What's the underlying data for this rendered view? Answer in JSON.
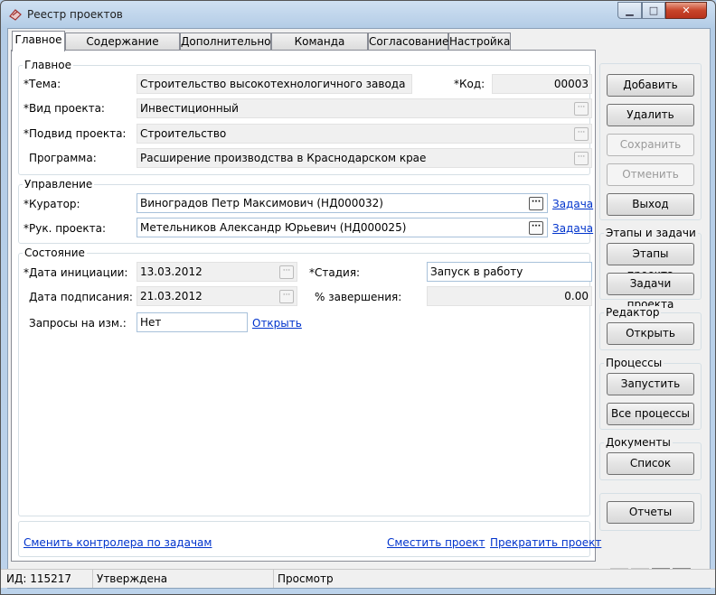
{
  "window": {
    "title": "Реестр проектов"
  },
  "tabs": [
    "Главное",
    "Содержание проекта",
    "Дополнительно",
    "Команда проекта",
    "Согласование",
    "Настройка"
  ],
  "main_group": {
    "title": "Главное",
    "tema_label": "*Тема:",
    "tema_value": "Строительство высокотехнологичного завода",
    "kod_label": "*Код:",
    "kod_value": "00003",
    "vid_label": "*Вид проекта:",
    "vid_value": "Инвестиционный",
    "podvid_label": "*Подвид проекта:",
    "podvid_value": "Строительство",
    "programma_label": "Программа:",
    "programma_value": "Расширение производства в Краснодарском крае"
  },
  "management": {
    "title": "Управление",
    "curator_label": "*Куратор:",
    "curator_value": "Виноградов Петр Максимович (НД000032)",
    "curator_link": "Задача",
    "head_label": "*Рук. проекта:",
    "head_value": "Метельников Александр Юрьевич (НД000025)",
    "head_link": "Задача"
  },
  "state": {
    "title": "Состояние",
    "init_label": "*Дата инициации:",
    "init_value": "13.03.2012",
    "sign_label": "Дата подписания:",
    "sign_value": "21.03.2012",
    "requests_label": "Запросы на изм.:",
    "requests_value": "Нет",
    "requests_link": "Открыть",
    "stage_label": "*Стадия:",
    "stage_value": "Запуск в работу",
    "percent_label": "% завершения:",
    "percent_value": "0.00"
  },
  "bottom_links": {
    "change_controller": "Сменить контролера по задачам",
    "move_project": "Сместить проект",
    "stop_project": "Прекратить проект"
  },
  "side": {
    "add": "Добавить",
    "delete": "Удалить",
    "save": "Сохранить",
    "cancel": "Отменить",
    "exit": "Выход",
    "stages_group": "Этапы и задачи",
    "stages_btn": "Этапы проекта",
    "tasks_btn": "Задачи проекта",
    "editor_group": "Редактор",
    "editor_open": "Открыть",
    "processes_group": "Процессы",
    "run": "Запустить",
    "all_processes": "Все процессы",
    "documents_group": "Документы",
    "list": "Список",
    "reports": "Отчеты"
  },
  "status": {
    "id": "ИД: 115217",
    "state": "Утверждена",
    "mode": "Просмотр"
  }
}
